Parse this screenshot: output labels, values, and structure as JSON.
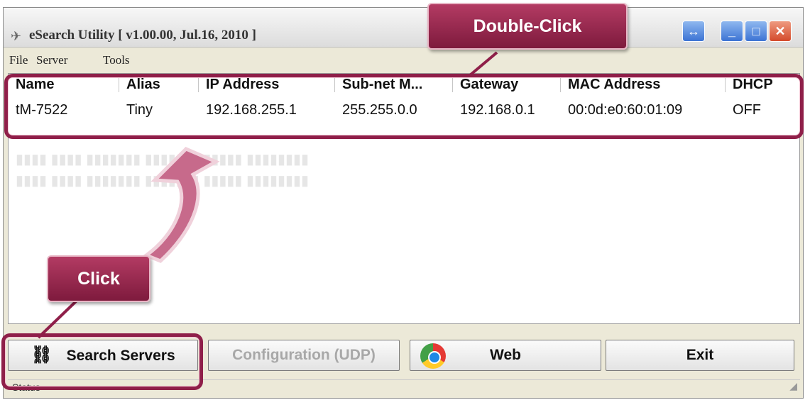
{
  "window": {
    "title": "eSearch Utility [ v1.00.00, Jul.16, 2010 ]"
  },
  "menu": [
    "File",
    "Server",
    "Tools"
  ],
  "table": {
    "headers": [
      "Name",
      "Alias",
      "IP Address",
      "Sub-net M...",
      "Gateway",
      "MAC Address",
      "DHCP"
    ],
    "rows": [
      [
        "tM-7522",
        "Tiny",
        "192.168.255.1",
        "255.255.0.0",
        "192.168.0.1",
        "00:0d:e0:60:01:09",
        "OFF"
      ]
    ]
  },
  "buttons": {
    "search": "Search Servers",
    "config": "Configuration (UDP)",
    "web": "Web",
    "exit": "Exit"
  },
  "status": "Status",
  "callouts": {
    "double_click": "Double-Click",
    "click": "Click"
  },
  "colors": {
    "callout": "#9b2b52",
    "highlight": "#8f1f49"
  }
}
